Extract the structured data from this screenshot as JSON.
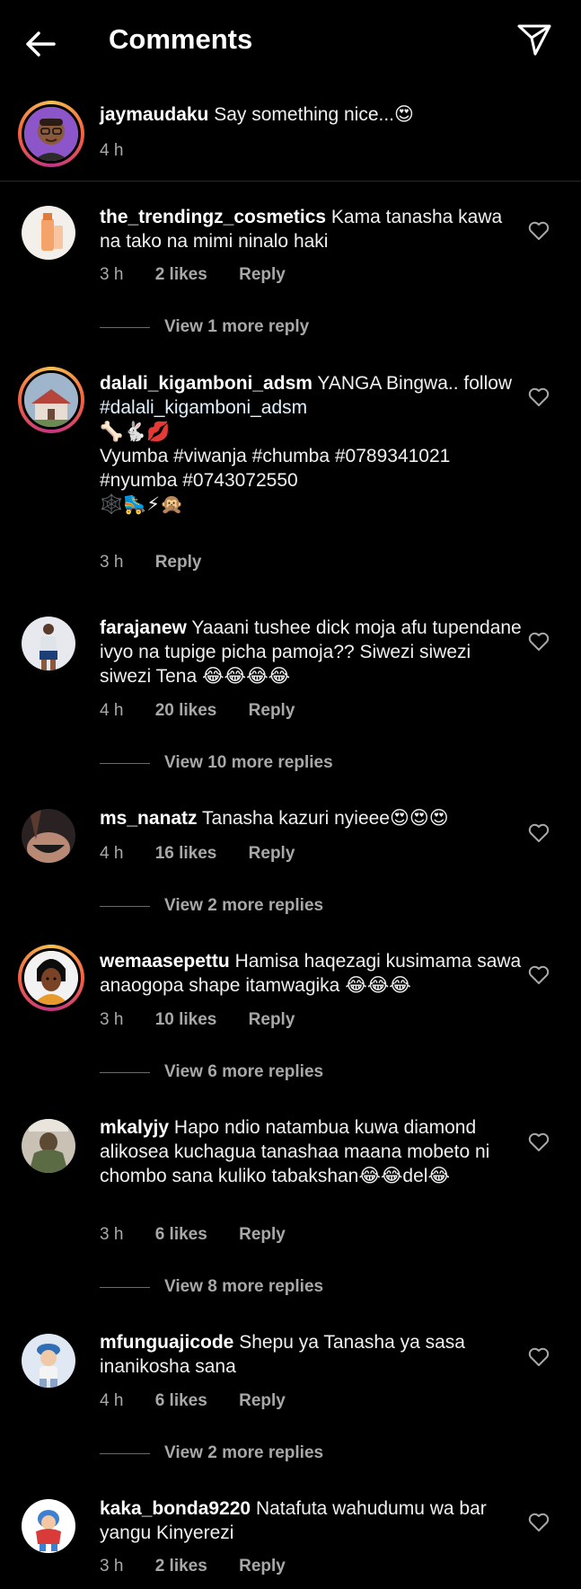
{
  "header": {
    "title": "Comments",
    "back_icon": "arrow-left-icon",
    "send_icon": "paper-plane-icon"
  },
  "caption": {
    "username": "jaymaudaku",
    "text": "Say something nice...😍",
    "time": "4 h"
  },
  "comments": [
    {
      "username": "the_trendingz_cosmetics",
      "text": "Kama tanasha kawa na tako na mimi ninalo  haki",
      "time": "3 h",
      "likes": "2 likes",
      "reply_label": "Reply",
      "view_replies": "View 1 more reply"
    },
    {
      "username": "dalali_kigamboni_adsm",
      "text": "YANGA Bingwa.. follow",
      "text_lines": [
        "#dalali_kigamboni_adsm",
        "🦴🐇💋",
        "Vyumba #viwanja #chumba #0789341021",
        "#nyumba #0743072550",
        "🕸️🛼⚡🙊"
      ],
      "time": "3 h",
      "reply_label": "Reply"
    },
    {
      "username": "farajanew",
      "text": "Yaaani tushee dick moja afu tupendane ivyo na tupige picha pamoja?? Siwezi siwezi siwezi Tena 😂😂😂😂",
      "time": "4 h",
      "likes": "20 likes",
      "reply_label": "Reply",
      "view_replies": "View 10 more replies"
    },
    {
      "username": "ms_nanatz",
      "text": "Tanasha kazuri nyieee😍😍😍",
      "time": "4 h",
      "likes": "16 likes",
      "reply_label": "Reply",
      "view_replies": "View 2 more replies"
    },
    {
      "username": "wemaasepettu",
      "text": "Hamisa haqezagi kusimama sawa anaogopa shape itamwagika 😂😂😂",
      "time": "3 h",
      "likes": "10 likes",
      "reply_label": "Reply",
      "view_replies": "View 6 more replies"
    },
    {
      "username": "mkalyjy",
      "text": "Hapo ndio natambua kuwa diamond alikosea kuchagua tanashaa maana mobeto ni chombo sana kuliko tabakshan😂😂del😂",
      "time": "3 h",
      "likes": "6 likes",
      "reply_label": "Reply",
      "view_replies": "View 8 more replies"
    },
    {
      "username": "mfunguajicode",
      "text": "Shepu ya Tanasha ya sasa inanikosha sana",
      "time": "4 h",
      "likes": "6 likes",
      "reply_label": "Reply",
      "view_replies": "View 2 more replies"
    },
    {
      "username": "kaka_bonda9220",
      "text": "Natafuta wahudumu wa bar yangu Kinyerezi",
      "time": "3 h",
      "likes": "2 likes",
      "reply_label": "Reply"
    }
  ],
  "icons": {
    "like": "heart-outline-icon"
  },
  "colors": {
    "background": "#000000",
    "muted_text": "#a8a8a8",
    "divider": "#262626"
  }
}
